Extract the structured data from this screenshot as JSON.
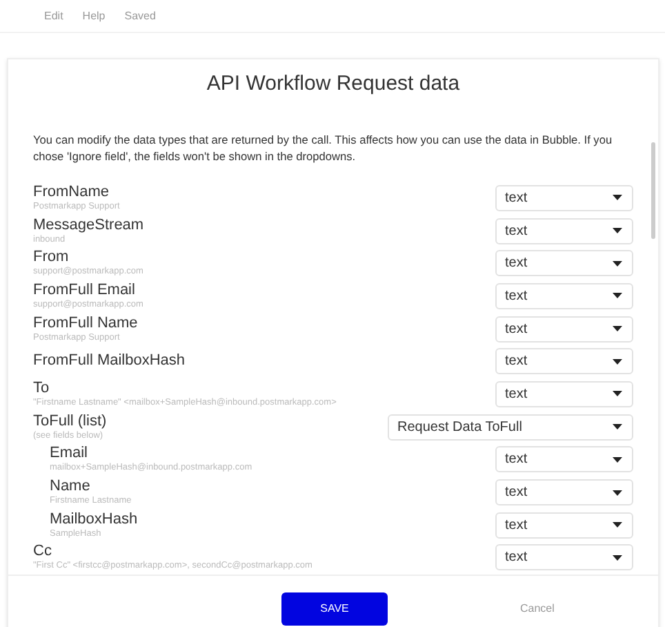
{
  "menu_bar": {
    "items": [
      "Edit",
      "Help",
      "Saved"
    ]
  },
  "dialog": {
    "title": "API Workflow Request data",
    "description": "You can modify the data types that are returned by the call. This affects how you can use the data in Bubble. If you chose 'Ignore field', the fields won't be shown in the dropdowns.",
    "fields": [
      {
        "label": "FromName",
        "sample": "Postmarkapp Support",
        "type": "text"
      },
      {
        "label": "MessageStream",
        "sample": "inbound",
        "type": "text"
      },
      {
        "label": "From",
        "sample": "support@postmarkapp.com",
        "type": "text"
      },
      {
        "label": "FromFull Email",
        "sample": "support@postmarkapp.com",
        "type": "text"
      },
      {
        "label": "FromFull Name",
        "sample": "Postmarkapp Support",
        "type": "text"
      },
      {
        "label": "FromFull MailboxHash",
        "type": "text"
      },
      {
        "label": "To",
        "sample": "\"Firstname Lastname\" <mailbox+SampleHash@inbound.postmarkapp.com>",
        "type": "text"
      },
      {
        "label": "ToFull (list)",
        "sample": "(see fields below)",
        "type": "Request Data ToFull",
        "children": [
          {
            "label": "Email",
            "sample": "mailbox+SampleHash@inbound.postmarkapp.com",
            "type": "text"
          },
          {
            "label": "Name",
            "sample": "Firstname Lastname",
            "type": "text"
          },
          {
            "label": "MailboxHash",
            "sample": "SampleHash",
            "type": "text"
          }
        ]
      },
      {
        "label": "Cc",
        "sample": "\"First Cc\" <firstcc@postmarkapp.com>, secondCc@postmarkapp.com",
        "type": "text"
      }
    ],
    "buttons": {
      "save": "SAVE",
      "cancel": "Cancel"
    }
  }
}
